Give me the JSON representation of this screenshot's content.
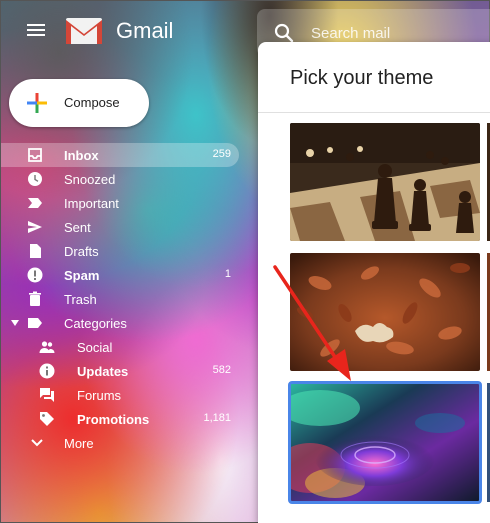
{
  "header": {
    "app_title": "Gmail",
    "search_placeholder": "Search mail"
  },
  "compose": {
    "label": "Compose"
  },
  "sidebar": {
    "items": [
      {
        "label": "Inbox",
        "count": "259",
        "icon": "inbox-icon",
        "active": true,
        "bold": true
      },
      {
        "label": "Snoozed",
        "count": "",
        "icon": "clock-icon"
      },
      {
        "label": "Important",
        "count": "",
        "icon": "important-icon"
      },
      {
        "label": "Sent",
        "count": "",
        "icon": "send-icon"
      },
      {
        "label": "Drafts",
        "count": "",
        "icon": "draft-icon"
      },
      {
        "label": "Spam",
        "count": "1",
        "icon": "spam-icon",
        "bold": true
      },
      {
        "label": "Trash",
        "count": "",
        "icon": "trash-icon"
      },
      {
        "label": "Categories",
        "count": "",
        "icon": "label-icon"
      },
      {
        "label": "Social",
        "count": "",
        "icon": "people-icon"
      },
      {
        "label": "Updates",
        "count": "582",
        "icon": "info-icon",
        "bold": true
      },
      {
        "label": "Forums",
        "count": "",
        "icon": "forum-icon"
      },
      {
        "label": "Promotions",
        "count": "1,181",
        "icon": "tag-icon",
        "bold": true
      },
      {
        "label": "More",
        "count": "",
        "icon": "chevron-down-icon"
      }
    ]
  },
  "theme_dialog": {
    "title": "Pick your theme",
    "themes": [
      {
        "name": "chess",
        "selected": false
      },
      {
        "name": "autumn-leaves",
        "selected": false
      },
      {
        "name": "water-droplet",
        "selected": true
      }
    ]
  },
  "colors": {
    "selection_outline": "#4a85e8",
    "annotation_arrow": "#e8251c",
    "gmail_red": "#d44638"
  }
}
